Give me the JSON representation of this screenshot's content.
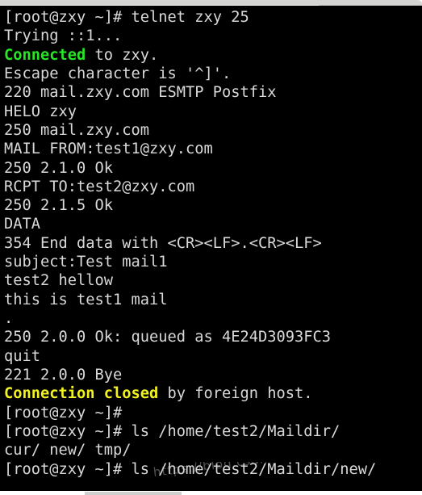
{
  "window": {
    "chrome_top_color": "#d4d4d2",
    "chrome_bottom_color": "#ffffff"
  },
  "terminal": {
    "background_color": "#000000",
    "default_text_color": "#d9d9d9",
    "green_color": "#26e626",
    "yellow_color": "#f2f21f",
    "prompt": "[root@zxy ~]#",
    "lines": [
      {
        "id": "line-1",
        "segments": [
          {
            "text": "[root@zxy ~]# telnet zxy 25",
            "color": "white"
          }
        ]
      },
      {
        "id": "line-2",
        "segments": [
          {
            "text": "Trying ::1...",
            "color": "white"
          }
        ]
      },
      {
        "id": "line-3",
        "segments": [
          {
            "text": "Connected",
            "color": "green"
          },
          {
            "text": " to zxy.",
            "color": "white"
          }
        ]
      },
      {
        "id": "line-4",
        "segments": [
          {
            "text": "Escape character is '^]'.",
            "color": "white"
          }
        ]
      },
      {
        "id": "line-5",
        "segments": [
          {
            "text": "220 mail.zxy.com ESMTP Postfix",
            "color": "white"
          }
        ]
      },
      {
        "id": "line-6",
        "segments": [
          {
            "text": "HELO zxy",
            "color": "white"
          }
        ]
      },
      {
        "id": "line-7",
        "segments": [
          {
            "text": "250 mail.zxy.com",
            "color": "white"
          }
        ]
      },
      {
        "id": "line-8",
        "segments": [
          {
            "text": "MAIL FROM:test1@zxy.com",
            "color": "white"
          }
        ]
      },
      {
        "id": "line-9",
        "segments": [
          {
            "text": "250 2.1.0 Ok",
            "color": "white"
          }
        ]
      },
      {
        "id": "line-10",
        "segments": [
          {
            "text": "RCPT TO:test2@zxy.com",
            "color": "white"
          }
        ]
      },
      {
        "id": "line-11",
        "segments": [
          {
            "text": "250 2.1.5 Ok",
            "color": "white"
          }
        ]
      },
      {
        "id": "line-12",
        "segments": [
          {
            "text": "DATA",
            "color": "white"
          }
        ]
      },
      {
        "id": "line-13",
        "segments": [
          {
            "text": "354 End data with <CR><LF>.<CR><LF>",
            "color": "white"
          }
        ]
      },
      {
        "id": "line-14",
        "segments": [
          {
            "text": "subject:Test mail1",
            "color": "white"
          }
        ]
      },
      {
        "id": "line-15",
        "segments": [
          {
            "text": "test2 hellow",
            "color": "white"
          }
        ]
      },
      {
        "id": "line-16",
        "segments": [
          {
            "text": "this is test1 mail",
            "color": "white"
          }
        ]
      },
      {
        "id": "line-17",
        "segments": [
          {
            "text": ".",
            "color": "white"
          }
        ]
      },
      {
        "id": "line-18",
        "segments": [
          {
            "text": "250 2.0.0 Ok: queued as 4E24D3093FC3",
            "color": "white"
          }
        ]
      },
      {
        "id": "line-19",
        "segments": [
          {
            "text": "quit",
            "color": "white"
          }
        ]
      },
      {
        "id": "line-20",
        "segments": [
          {
            "text": "221 2.0.0 Bye",
            "color": "white"
          }
        ]
      },
      {
        "id": "line-21",
        "segments": [
          {
            "text": "Connection closed",
            "color": "yellow"
          },
          {
            "text": " by foreign host.",
            "color": "white"
          }
        ]
      },
      {
        "id": "line-22",
        "segments": [
          {
            "text": "[root@zxy ~]#",
            "color": "white"
          }
        ]
      },
      {
        "id": "line-23",
        "segments": [
          {
            "text": "[root@zxy ~]# ls /home/test2/Maildir/",
            "color": "white"
          }
        ]
      },
      {
        "id": "line-24",
        "segments": [
          {
            "text": "cur/ new/ tmp/",
            "color": "white"
          }
        ]
      },
      {
        "id": "line-25",
        "segments": [
          {
            "text": "[root@zxy ~]# ls /home/test2/Maildir/new/",
            "color": "white"
          }
        ]
      }
    ]
  },
  "watermark": {
    "text": "https://blog.csdn.net/TO1723"
  }
}
